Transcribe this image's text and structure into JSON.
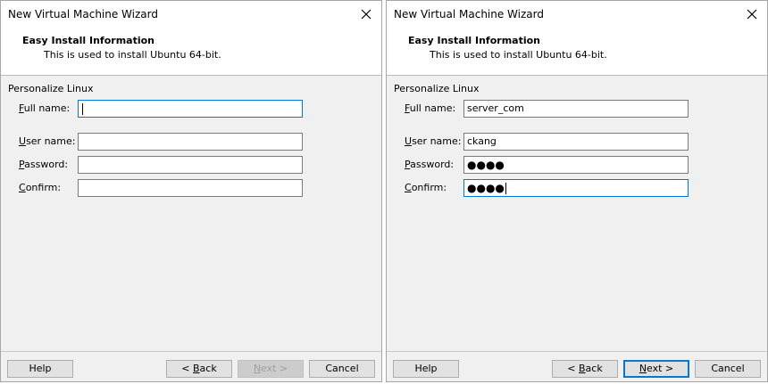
{
  "dialogs": [
    {
      "title": "New Virtual Machine Wizard",
      "header_title": "Easy Install Information",
      "header_subtitle": "This is used to install Ubuntu 64-bit.",
      "group_label": "Personalize Linux",
      "fields": {
        "full_name": {
          "label_mnemonic": "F",
          "label_rest": "ull name:",
          "value": ""
        },
        "user_name": {
          "label_mnemonic": "U",
          "label_rest": "ser name:",
          "value": ""
        },
        "password": {
          "label_mnemonic": "P",
          "label_rest": "assword:",
          "value": ""
        },
        "confirm": {
          "label_mnemonic": "C",
          "label_rest": "onfirm:",
          "value": ""
        }
      },
      "focused_field": "full_name",
      "buttons": {
        "help": "Help",
        "back_prefix": "< ",
        "back_mnemonic": "B",
        "back_rest": "ack",
        "next_mnemonic": "N",
        "next_rest": "ext >",
        "cancel": "Cancel"
      },
      "next_enabled": false
    },
    {
      "title": "New Virtual Machine Wizard",
      "header_title": "Easy Install Information",
      "header_subtitle": "This is used to install Ubuntu 64-bit.",
      "group_label": "Personalize Linux",
      "fields": {
        "full_name": {
          "label_mnemonic": "F",
          "label_rest": "ull name:",
          "value": "server_com"
        },
        "user_name": {
          "label_mnemonic": "U",
          "label_rest": "ser name:",
          "value": "ckang"
        },
        "password": {
          "label_mnemonic": "P",
          "label_rest": "assword:",
          "value": "●●●●"
        },
        "confirm": {
          "label_mnemonic": "C",
          "label_rest": "onfirm:",
          "value": "●●●●"
        }
      },
      "focused_field": "confirm",
      "buttons": {
        "help": "Help",
        "back_prefix": "< ",
        "back_mnemonic": "B",
        "back_rest": "ack",
        "next_mnemonic": "N",
        "next_rest": "ext >",
        "cancel": "Cancel"
      },
      "next_enabled": true
    }
  ]
}
